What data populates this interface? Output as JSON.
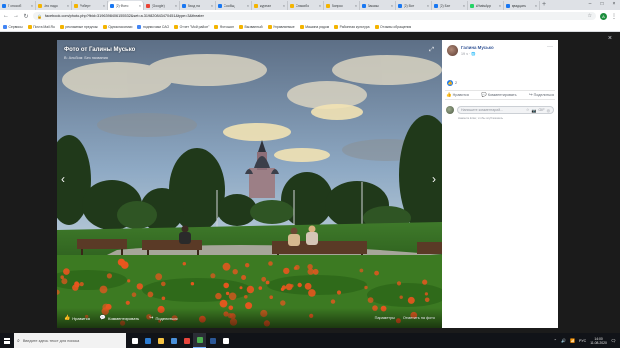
{
  "browser": {
    "tabs": [
      {
        "title": "7 способ",
        "color": "#1877f2",
        "active": false
      },
      {
        "title": "Что надо",
        "color": "#f4b400",
        "active": false
      },
      {
        "title": "Роберт",
        "color": "#f4b400",
        "active": false
      },
      {
        "title": "(2) Фото",
        "color": "#1877f2",
        "active": true
      },
      {
        "title": "(Google)",
        "color": "#ea4335",
        "active": false
      },
      {
        "title": "Вход на",
        "color": "#1877f2",
        "active": false
      },
      {
        "title": "Сообщ",
        "color": "#1877f2",
        "active": false
      },
      {
        "title": "журнал",
        "color": "#f4b400",
        "active": false
      },
      {
        "title": "Спасибо",
        "color": "#f4b400",
        "active": false
      },
      {
        "title": "Вопрос",
        "color": "#f4b400",
        "active": false
      },
      {
        "title": "Заказы",
        "color": "#1877f2",
        "active": false
      },
      {
        "title": "(2) Вот",
        "color": "#1877f2",
        "active": false
      },
      {
        "title": "(2) Бат",
        "color": "#1877f2",
        "active": false
      },
      {
        "title": "WhatsApp",
        "color": "#25d366",
        "active": false
      },
      {
        "title": "двадцать",
        "color": "#1877f2",
        "active": false
      }
    ],
    "close_tab_glyph": "×",
    "new_tab_glyph": "+",
    "window_controls": {
      "minimize": "–",
      "maximize": "□",
      "close": "×"
    },
    "back_glyph": "←",
    "forward_glyph": "→",
    "reload_glyph": "↻",
    "lock_glyph": "🔒",
    "url": "facebook.com/photo.php?fbid=3196398406155532&set=a.319820843470451&type=3&theater",
    "star_glyph": "☆",
    "profile_letter": "А",
    "menu_glyph": "⋮",
    "bookmarks": [
      {
        "label": "Сервисы",
        "color": "#4285f4"
      },
      {
        "label": "Почта Mail.Ru",
        "color": "#f4b400"
      },
      {
        "label": "рекламные предлож",
        "color": "#f4b400"
      },
      {
        "label": "Одноклассники",
        "color": "#f4b400"
      },
      {
        "label": "подписчики САО",
        "color": "#4285f4"
      },
      {
        "label": "Отчет \"Мой район\"",
        "color": "#f4b400"
      },
      {
        "label": "Фотошоп",
        "color": "#f4b400"
      },
      {
        "label": "Вызванный",
        "color": "#f4b400"
      },
      {
        "label": "Управляемые",
        "color": "#f4b400"
      },
      {
        "label": "Машина рядом",
        "color": "#f4b400"
      },
      {
        "label": "Районная культура",
        "color": "#f4b400"
      },
      {
        "label": "Отзывы обращения",
        "color": "#f4b400"
      }
    ]
  },
  "theater": {
    "close_glyph": "×",
    "photo": {
      "title": "Фото от Галины Мусько",
      "subtitle": "В: Альбом: Без названия",
      "expand_glyph": "⤢",
      "prev_glyph": "‹",
      "next_glyph": "›",
      "actions": [
        {
          "icon": "👍",
          "label": "Нравится"
        },
        {
          "icon": "💬",
          "label": "Комментировать"
        },
        {
          "icon": "↪",
          "label": "Поделиться"
        }
      ],
      "footer_right": [
        "Параметры",
        "Отметить на фото"
      ]
    },
    "post": {
      "author": "Галина Мусько",
      "date": "19 ч · 🌐",
      "more_glyph": "···",
      "likes": "2",
      "like_glyph": "👍",
      "actions": [
        {
          "icon": "👍",
          "label": "Нравится"
        },
        {
          "icon": "💬",
          "label": "Комментировать"
        },
        {
          "icon": "↪",
          "label": "Поделиться"
        }
      ],
      "comment_placeholder": "Напишите комментарий...",
      "comment_icons": [
        "☺",
        "📷",
        "GIF",
        "◎"
      ],
      "comment_hint": "Нажмите Enter, чтобы опубликовать"
    }
  },
  "taskbar": {
    "search_placeholder": "Введите здесь текст для поиска",
    "search_glyph": "⌕",
    "apps": [
      {
        "color": "#ffffff",
        "active": false
      },
      {
        "color": "#2d7dd2",
        "active": false
      },
      {
        "color": "#f6c343",
        "active": false
      },
      {
        "color": "#4a90d9",
        "active": false
      },
      {
        "color": "#e8453c",
        "active": false
      },
      {
        "color": "#4caf50",
        "active": true
      },
      {
        "color": "#2b5797",
        "active": false
      },
      {
        "color": "#ffffff",
        "active": false
      }
    ],
    "tray_icons": [
      "⌃",
      "🔊",
      "📶"
    ],
    "language": "РУС",
    "time": "14:00",
    "date": "11.08.2020",
    "notify_glyph": "🗨"
  }
}
